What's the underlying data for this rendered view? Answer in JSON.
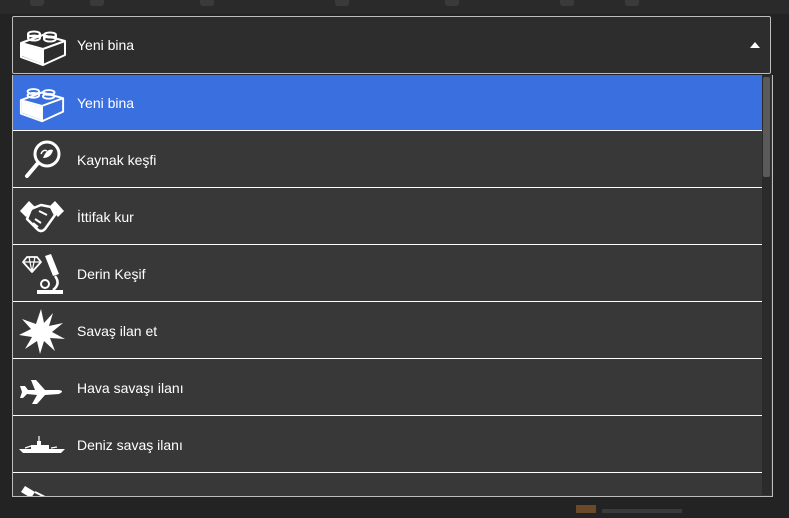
{
  "selected": {
    "label": "Yeni bina",
    "icon": "brick-icon"
  },
  "options": [
    {
      "label": "Yeni bina",
      "icon": "brick-icon",
      "selected": true
    },
    {
      "label": "Kaynak keşfi",
      "icon": "magnifier-leaf-icon",
      "selected": false
    },
    {
      "label": "İttifak kur",
      "icon": "handshake-icon",
      "selected": false
    },
    {
      "label": "Derin Keşif",
      "icon": "microscope-diamond-icon",
      "selected": false
    },
    {
      "label": "Savaş ilan et",
      "icon": "explosion-icon",
      "selected": false
    },
    {
      "label": "Hava savaşı ilanı",
      "icon": "airplane-icon",
      "selected": false
    },
    {
      "label": "Deniz savaş ilanı",
      "icon": "warship-icon",
      "selected": false
    },
    {
      "label": "",
      "icon": "partial-item-icon",
      "selected": false
    }
  ],
  "colors": {
    "highlight": "#3a6fe0",
    "list_bg": "#383838",
    "header_bg": "#2d2d2d",
    "border": "#bdbdbd"
  }
}
